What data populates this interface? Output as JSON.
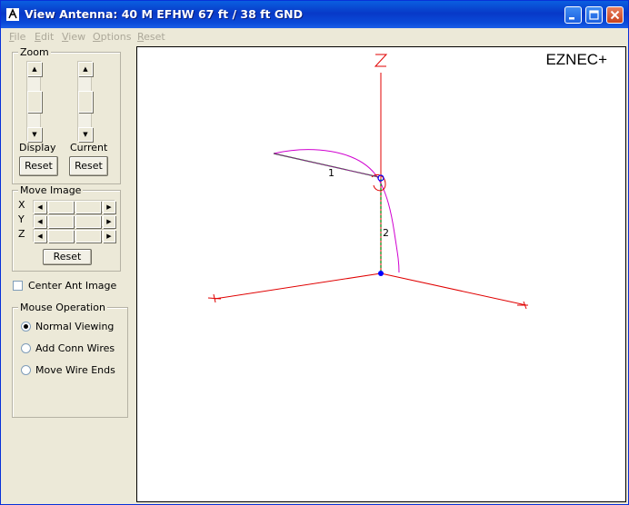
{
  "window": {
    "title": "View Antenna: 40 M EFHW 67 ft / 38 ft GND"
  },
  "menu": [
    {
      "label": "File",
      "key": "F",
      "rest": "ile"
    },
    {
      "label": "Edit",
      "key": "E",
      "rest": "dit"
    },
    {
      "label": "View",
      "key": "V",
      "rest": "iew"
    },
    {
      "label": "Options",
      "key": "O",
      "rest": "ptions"
    },
    {
      "label": "Reset",
      "key": "R",
      "rest": "eset"
    }
  ],
  "zoom": {
    "group_label": "Zoom",
    "display_label": "Display",
    "current_label": "Current",
    "display_reset": "Reset",
    "current_reset": "Reset"
  },
  "move_image": {
    "group_label": "Move Image",
    "axes": [
      "X",
      "Y",
      "Z"
    ],
    "reset": "Reset"
  },
  "center_ant_image": {
    "label": "Center Ant Image",
    "checked": false
  },
  "mouse_operation": {
    "group_label": "Mouse Operation",
    "options": [
      {
        "label": "Normal Viewing",
        "selected": true
      },
      {
        "label": "Add Conn Wires",
        "selected": false
      },
      {
        "label": "Move Wire Ends",
        "selected": false
      }
    ]
  },
  "view": {
    "brand": "EZNEC+",
    "wire_labels": [
      "1",
      "2"
    ],
    "colors": {
      "axis": "#e00000",
      "wire1": "#006400",
      "wire2": "#008000",
      "pattern": "#d000d0",
      "source": "#0000ff"
    }
  }
}
